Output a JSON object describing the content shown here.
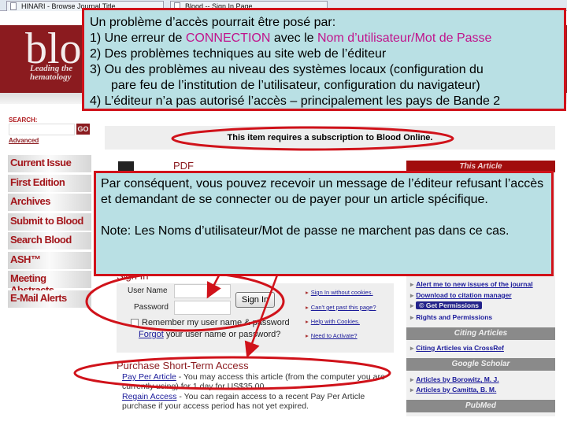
{
  "browser": {
    "tabs": [
      "HINARI - Browse Journal Title",
      "Blood -- Sign In Page"
    ]
  },
  "header": {
    "logo": "blood",
    "tagline_1": "Leading the",
    "tagline_2": "hematology"
  },
  "search": {
    "label": "SEARCH:",
    "go": "GO",
    "advanced": "Advanced"
  },
  "nav": [
    "Current Issue",
    "First Edition",
    "Archives",
    "Submit to Blood",
    "Search Blood",
    "ASH™",
    "Meeting Abstracts",
    "E-Mail Alerts"
  ],
  "banner": "This item requires a subscription to Blood Online.",
  "pdf": "PDF",
  "callout_top": {
    "intro": "Un problème d’accès pourrait être posé par:",
    "item1_pre": "1)  Une erreur de ",
    "item1_hl1": "CONNECTION",
    "item1_mid": " avec le ",
    "item1_hl2": "Nom d’utilisateur/Mot de Passe",
    "item2": "2)  Des problèmes techniques au site web de l’éditeur",
    "item3a": "3)  Ou des problèmes au niveau des systèmes locaux (configuration  du",
    "item3b": "pare feu de l’institution de l’utilisateur, configuration du navigateur)",
    "item4": "4) L’éditeur n’a pas autorisé l’accès – principalement les pays de Bande 2"
  },
  "callout_mid": {
    "p1": "Par conséquent, vous pouvez recevoir un message de l’éditeur refusant l’accès et demandant de se connecter ou de payer pour un article spécifique.",
    "p2": "Note: Les Noms d’utilisateur/Mot de passe ne marchent pas dans ce cas."
  },
  "signin": {
    "title": "Sign In",
    "user_label": "User Name",
    "password_label": "Password",
    "button": "Sign In",
    "remember": "Remember my user name & password",
    "forgot_link": "Forgot",
    "forgot_rest": " your user name or password?",
    "side_links": [
      "Sign In without cookies.",
      "Can't get past this page?",
      "Help with Cookies.",
      "Need to Activate?"
    ]
  },
  "purchase": {
    "title": "Purchase Short-Term Access",
    "ppa_link": "Pay Per Article",
    "ppa_text": " - You may access this article (from the computer you are currently using) for 1 day for US$35.00",
    "regain_link": "Regain Access",
    "regain_text": " - You can regain access to a recent Pay Per Article purchase if your access period has not yet expired."
  },
  "right": {
    "this_article": "This Article",
    "links1": [
      "Alert me to new issues of the journal",
      "Download to citation manager"
    ],
    "permissions_button": "© Get Permissions",
    "rights": "Rights and Permissions",
    "citing_head": "Citing Articles",
    "citing_link": "Citing Articles via CrossRef",
    "scholar_head": "Google Scholar",
    "scholar_links": [
      "Articles by Borowitz, M. J.",
      "Articles by Camitta, B. M."
    ],
    "pubmed_head": "PubMed"
  },
  "colors": {
    "callout_bg": "#b9e0e4",
    "callout_border": "#d0121a",
    "highlight": "#c0148c",
    "brand": "#8b1b1f"
  }
}
